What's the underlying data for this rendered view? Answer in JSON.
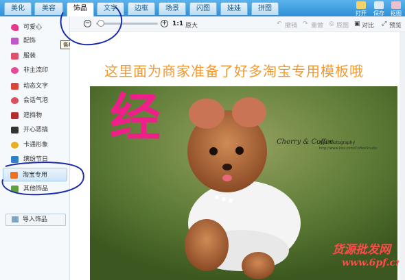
{
  "tabs": [
    {
      "label": "美化"
    },
    {
      "label": "美容"
    },
    {
      "label": "饰品"
    },
    {
      "label": "文字"
    },
    {
      "label": "边框"
    },
    {
      "label": "场景"
    },
    {
      "label": "闪图"
    },
    {
      "label": "娃娃"
    },
    {
      "label": "拼图"
    }
  ],
  "top_buttons": [
    {
      "label": "打开"
    },
    {
      "label": "保存"
    },
    {
      "label": "抠图"
    }
  ],
  "toolbar": {
    "zoom_ratio": "1:1",
    "original_size": "原大",
    "undo": "撤销",
    "redo": "重做",
    "original": "原图",
    "compare": "对比",
    "preview": "预览"
  },
  "sidebar": {
    "items": [
      {
        "label": "可爱心",
        "icon": "heart-icon",
        "color": "#e83a8c"
      },
      {
        "label": "配饰",
        "icon": "bow-icon",
        "color": "#c058c8"
      },
      {
        "label": "服装",
        "icon": "dress-icon",
        "color": "#e0506a"
      },
      {
        "label": "非主流印",
        "icon": "heart-stamp-icon",
        "color": "#e64a9a"
      },
      {
        "label": "动态文字",
        "icon": "text-icon",
        "color": "#d8483a"
      },
      {
        "label": "会话气泡",
        "icon": "speech-bubble-icon",
        "color": "#d85060"
      },
      {
        "label": "遮挡物",
        "icon": "mask-icon",
        "color": "#b03030"
      },
      {
        "label": "开心恶搞",
        "icon": "glasses-icon",
        "color": "#333333"
      },
      {
        "label": "卡通形象",
        "icon": "cartoon-icon",
        "color": "#e8b020"
      },
      {
        "label": "缤纷节日",
        "icon": "gift-icon",
        "color": "#3080c8"
      },
      {
        "label": "淘宝专用",
        "icon": "taobao-icon",
        "color": "#f07020"
      },
      {
        "label": "其他饰品",
        "icon": "star-icon",
        "color": "#60a040"
      }
    ],
    "import_label": "导入饰品"
  },
  "tooltip": "各种心型饰品",
  "canvas": {
    "headline": "这里面为商家准备了好多淘宝专用模板哦",
    "big_char": "经",
    "watermark_script": "Cherry & Coffee",
    "watermark_studio": "Kiss Photography",
    "watermark_url": "http://www.kiss.com/CoffeeStudio",
    "corner_text_1": "货源批发网",
    "corner_text_2": "www.6pf.cn"
  },
  "colors": {
    "tab_bar": "#2f8fd6",
    "headline": "#f29a2e",
    "big_char": "#ef1f8a",
    "annotation": "#1a2aa8"
  }
}
